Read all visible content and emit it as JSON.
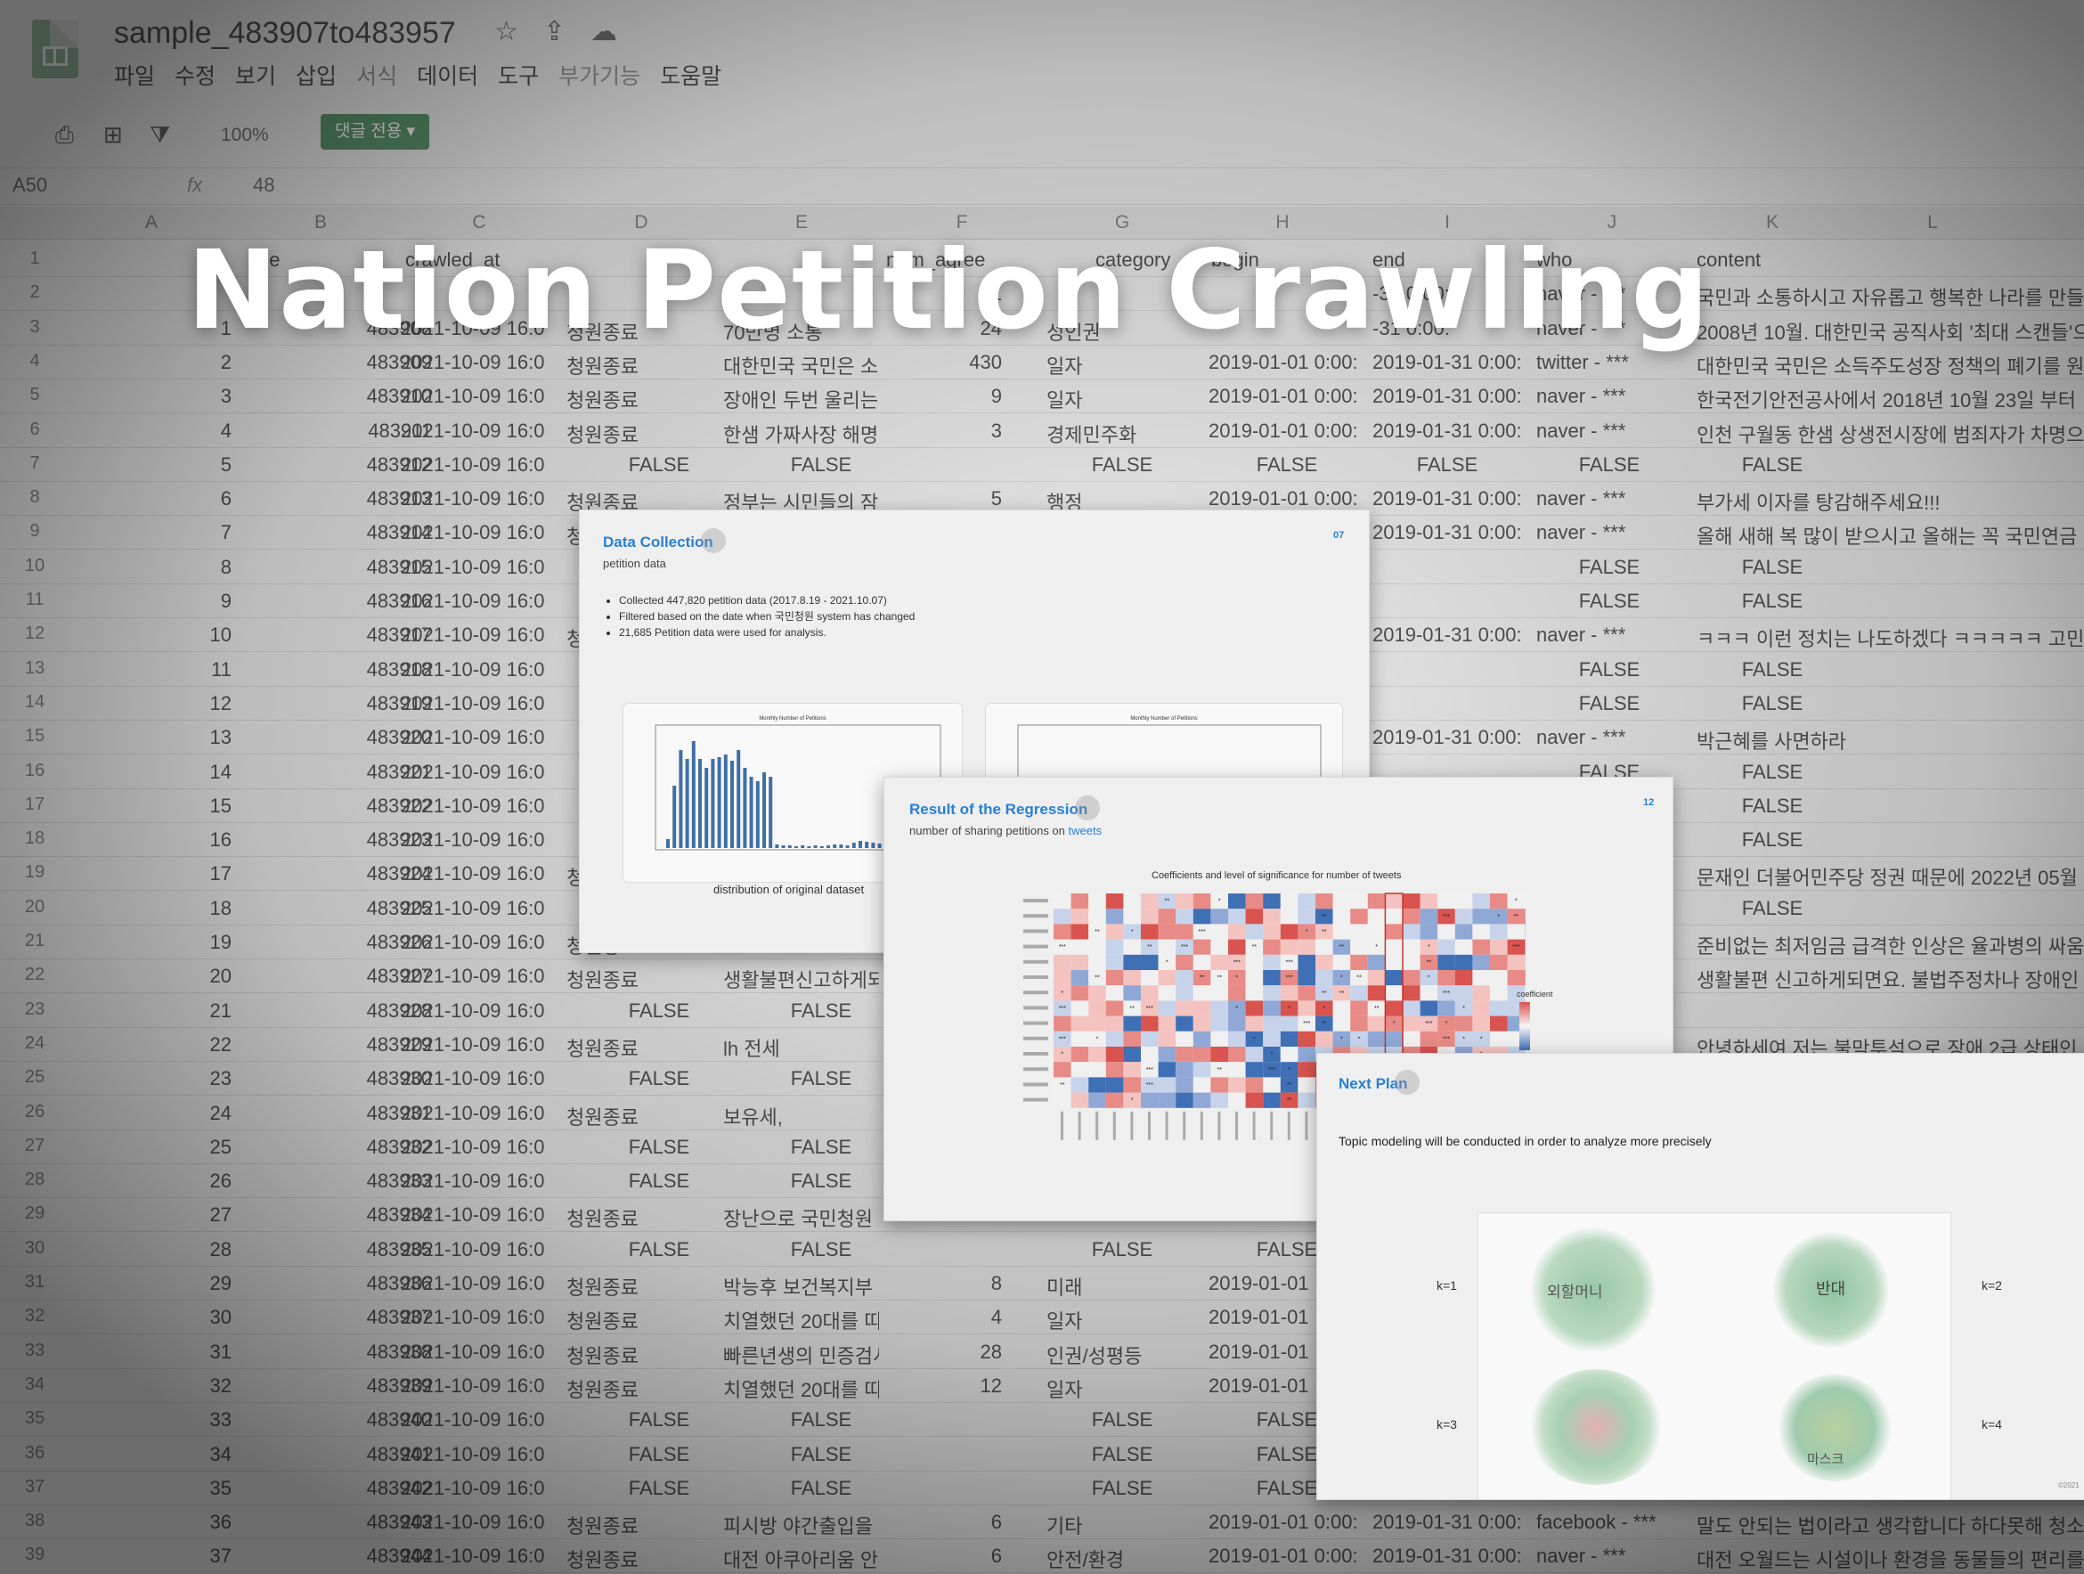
{
  "app": {
    "doc_title": "sample_483907to483957",
    "menu": [
      "파일",
      "수정",
      "보기",
      "삽입",
      "서식",
      "데이터",
      "도구",
      "부가기능",
      "도움말"
    ],
    "menu_dim": [
      false,
      false,
      false,
      false,
      true,
      false,
      false,
      true,
      false
    ],
    "zoom": "100%",
    "comment_button": "댓글 전용",
    "name_box": "A50",
    "fx": "fx",
    "formula_value": "48"
  },
  "columns": [
    "A",
    "B",
    "C",
    "D",
    "E",
    "F",
    "G",
    "H",
    "I",
    "J",
    "K",
    "L"
  ],
  "header_row": {
    "b": "ge",
    "c": "crawled_at",
    "f": "num_agree",
    "g": "category",
    "h": "begin",
    "i": "end",
    "j": "who",
    "k": "content"
  },
  "rows": [
    {
      "n": "2",
      "a": "",
      "b": "",
      "c": "",
      "d": "",
      "e": "",
      "f": "1",
      "g": "",
      "h": "",
      "i": "-31 0:00:",
      "j": "naver - ***",
      "k": "국민과 소통하시고 자유롭고 행복한 나라를 만들"
    },
    {
      "n": "3",
      "a": "1",
      "b": "483908",
      "c": "2021-10-09 16:0",
      "d": "청원종료",
      "e": "70만명 소통",
      "f": "24",
      "g": "성인권",
      "h": "",
      "i": "-31 0:00:",
      "j": "naver - ***",
      "k": "2008년 10월. 대한민국 공직사회 '최대 스캔들'으"
    },
    {
      "n": "4",
      "a": "2",
      "b": "483909",
      "c": "2021-10-09 16:0",
      "d": "청원종료",
      "e": "대한민국 국민은 소",
      "f": "430",
      "g": "일자",
      "h": "2019-01-01 0:00:",
      "i": "2019-01-31 0:00:",
      "j": "twitter - ***",
      "k": "대한민국 국민은 소득주도성장 정책의 폐기를 원"
    },
    {
      "n": "5",
      "a": "3",
      "b": "483910",
      "c": "2021-10-09 16:0",
      "d": "청원종료",
      "e": "장애인 두번 울리는",
      "f": "9",
      "g": "일자",
      "h": "2019-01-01 0:00:",
      "i": "2019-01-31 0:00:",
      "j": "naver - ***",
      "k": "한국전기안전공사에서 2018년 10월 23일 부터"
    },
    {
      "n": "6",
      "a": "4",
      "b": "483911",
      "c": "2021-10-09 16:0",
      "d": "청원종료",
      "e": "한샘 가짜사장 해명",
      "f": "3",
      "g": "경제민주화",
      "h": "2019-01-01 0:00:",
      "i": "2019-01-31 0:00:",
      "j": "naver - ***",
      "k": "인천 구월동 한샘 상생전시장에 범죄자가 차명으"
    },
    {
      "n": "7",
      "a": "5",
      "b": "483912",
      "c": "2021-10-09 16:0",
      "false": true
    },
    {
      "n": "8",
      "a": "6",
      "b": "483913",
      "c": "2021-10-09 16:0",
      "d": "청원종료",
      "e": "정부는 시민들의 잠",
      "f": "5",
      "g": "행정",
      "h": "2019-01-01 0:00:",
      "i": "2019-01-31 0:00:",
      "j": "naver - ***",
      "k": "부가세 이자를 탕감해주세요!!!"
    },
    {
      "n": "9",
      "a": "7",
      "b": "483914",
      "c": "2021-10-09 16:0",
      "d": "청원종료",
      "e": "",
      "f": "",
      "g": "",
      "h": "",
      "i": "2019-01-31 0:00:",
      "j": "naver - ***",
      "k": "올해 새해 복 많이 받으시고 올해는 꼭 국민연금"
    },
    {
      "n": "10",
      "a": "8",
      "b": "483915",
      "c": "2021-10-09 16:0",
      "partial": "FALSE"
    },
    {
      "n": "11",
      "a": "9",
      "b": "483916",
      "c": "2021-10-09 16:0",
      "partial": "FALSE"
    },
    {
      "n": "12",
      "a": "10",
      "b": "483917",
      "c": "2021-10-09 16:0",
      "d": "청원종료",
      "e": "",
      "f": "",
      "g": "",
      "h": "",
      "i": "2019-01-31 0:00:",
      "j": "naver - ***",
      "k": "ㅋㅋㅋ 이런 정치는 나도하겠다 ㅋㅋㅋㅋㅋ 고민"
    },
    {
      "n": "13",
      "a": "11",
      "b": "483918",
      "c": "2021-10-09 16:0",
      "partial": "FALSE"
    },
    {
      "n": "14",
      "a": "12",
      "b": "483919",
      "c": "2021-10-09 16:0",
      "partial": "FALSE"
    },
    {
      "n": "15",
      "a": "13",
      "b": "483920",
      "c": "2021-10-09 16:0",
      "d": "",
      "e": "",
      "f": "",
      "g": "",
      "h": "",
      "i": "2019-01-31 0:00:",
      "j": "naver - ***",
      "k": "박근혜를 사면하라"
    },
    {
      "n": "16",
      "a": "14",
      "b": "483921",
      "c": "2021-10-09 16:0",
      "partial": "FALSE"
    },
    {
      "n": "17",
      "a": "15",
      "b": "483922",
      "c": "2021-10-09 16:0",
      "partial": "FALSE"
    },
    {
      "n": "18",
      "a": "16",
      "b": "483923",
      "c": "2021-10-09 16:0",
      "partial": "FALSE"
    },
    {
      "n": "19",
      "a": "17",
      "b": "483924",
      "c": "2021-10-09 16:0",
      "d": "청원종료",
      "e": "",
      "f": "",
      "g": "",
      "h": "",
      "i": "",
      "j": "",
      "k": "문재인 더불어민주당 정권 때문에 2022년 05월"
    },
    {
      "n": "20",
      "a": "18",
      "b": "483925",
      "c": "2021-10-09 16:0",
      "partial": "FALSE"
    },
    {
      "n": "21",
      "a": "19",
      "b": "483926",
      "c": "2021-10-09 16:0",
      "d": "청원종료",
      "e": "",
      "f": "",
      "g": "",
      "h": "",
      "i": "",
      "j": "",
      "k": "준비없는 최저임금 급격한 인상은  율과병의 싸움"
    },
    {
      "n": "22",
      "a": "20",
      "b": "483927",
      "c": "2021-10-09 16:0",
      "d": "청원종료",
      "e": "생활불편신고하게되",
      "f": "",
      "g": "",
      "h": "",
      "i": "",
      "j": "",
      "k": "생활불편 신고하게되면요. 불법주정차나 장애인"
    },
    {
      "n": "23",
      "a": "21",
      "b": "483928",
      "c": "2021-10-09 16:0",
      "false_short": true
    },
    {
      "n": "24",
      "a": "22",
      "b": "483929",
      "c": "2021-10-09 16:0",
      "d": "청원종료",
      "e": "lh 전세",
      "f": "",
      "g": "",
      "h": "",
      "i": "",
      "j": "",
      "k": "안녕하세여 저는 불막투석으로 장애 2급 상태인"
    },
    {
      "n": "25",
      "a": "23",
      "b": "483930",
      "c": "2021-10-09 16:0",
      "false_short": true
    },
    {
      "n": "26",
      "a": "24",
      "b": "483931",
      "c": "2021-10-09 16:0",
      "d": "청원종료",
      "e": "보유세,",
      "f": "",
      "g": "",
      "h": "",
      "i": "",
      "j": "",
      "k": ""
    },
    {
      "n": "27",
      "a": "25",
      "b": "483932",
      "c": "2021-10-09 16:0",
      "false_short": true
    },
    {
      "n": "28",
      "a": "26",
      "b": "483933",
      "c": "2021-10-09 16:0",
      "false_short": true
    },
    {
      "n": "29",
      "a": "27",
      "b": "483934",
      "c": "2021-10-09 16:0",
      "d": "청원종료",
      "e": "장난으로 국민청원",
      "f": "",
      "g": "",
      "h": "",
      "i": "",
      "j": "",
      "k": ""
    },
    {
      "n": "30",
      "a": "28",
      "b": "483935",
      "c": "2021-10-09 16:0",
      "false_short": true
    },
    {
      "n": "31",
      "a": "29",
      "b": "483936",
      "c": "2021-10-09 16:0",
      "d": "청원종료",
      "e": "박능후 보건복지부",
      "f": "8",
      "g": "미래",
      "h": "2019-01-01",
      "i": "",
      "j": "",
      "k": ""
    },
    {
      "n": "32",
      "a": "30",
      "b": "483937",
      "c": "2021-10-09 16:0",
      "d": "청원종료",
      "e": "치열했던 20대를 띠",
      "f": "4",
      "g": "일자",
      "h": "2019-01-01",
      "i": "",
      "j": "",
      "k": ""
    },
    {
      "n": "33",
      "a": "31",
      "b": "483938",
      "c": "2021-10-09 16:0",
      "d": "청원종료",
      "e": "빠른년생의 민증검시",
      "f": "28",
      "g": "인권/성평등",
      "h": "2019-01-01",
      "i": "",
      "j": "",
      "k": ""
    },
    {
      "n": "34",
      "a": "32",
      "b": "483939",
      "c": "2021-10-09 16:0",
      "d": "청원종료",
      "e": "치열했던 20대를 띠",
      "f": "12",
      "g": "일자",
      "h": "2019-01-01",
      "i": "",
      "j": "",
      "k": ""
    },
    {
      "n": "35",
      "a": "33",
      "b": "483940",
      "c": "2021-10-09 16:0",
      "false_short": true
    },
    {
      "n": "36",
      "a": "34",
      "b": "483941",
      "c": "2021-10-09 16:0",
      "false_short": true
    },
    {
      "n": "37",
      "a": "35",
      "b": "483942",
      "c": "2021-10-09 16:0",
      "false_short": true
    },
    {
      "n": "38",
      "a": "36",
      "b": "483943",
      "c": "2021-10-09 16:0",
      "d": "청원종료",
      "e": "피시방 야간출입을",
      "f": "6",
      "g": "기타",
      "h": "2019-01-01 0:00:",
      "i": "2019-01-31 0:00:",
      "j": "facebook - ***",
      "k": "말도 안되는 법이라고 생각합니다 하다못해 청소"
    },
    {
      "n": "39",
      "a": "37",
      "b": "483944",
      "c": "2021-10-09 16:0",
      "d": "청원종료",
      "e": "대전 아쿠아리움 안",
      "f": "6",
      "g": "안전/환경",
      "h": "2019-01-01 0:00:",
      "i": "2019-01-31 0:00:",
      "j": "naver - ***",
      "k": "대전 오월드는 시설이나 환경을 동물들의 편리를"
    }
  ],
  "false_text": "FALSE",
  "hero_title": "Nation Petition Crawling",
  "slide1": {
    "title": "Data Collection",
    "subtitle": "petition data",
    "page": "07",
    "bullets": [
      "Collected 447,820 petition data (2017.8.19 - 2021.10.07)",
      "Filtered based on the date when 국민청원 system has changed",
      "21,685 Petition data were used for analysis."
    ],
    "chart1_title": "Monthly Number of Petitions",
    "chart2_title": "Monthly Number of Petitions",
    "caption": "distribution of original dataset"
  },
  "slide2": {
    "title": "Result of the Regression",
    "subtitle_pre": "number of sharing petitions on ",
    "subtitle_link": "tweets",
    "page": "12",
    "heatmap_title": "Coefficients and level of significance for number of tweets",
    "legend_title": "coefficient"
  },
  "slide3": {
    "title": "Next Plan",
    "text": "Topic modeling will be conducted in order to analyze more precisely",
    "k_labels": [
      "k=1",
      "k=2",
      "k=3",
      "k=4"
    ],
    "cloud_words": [
      "외할머니",
      "반대",
      "마스크"
    ],
    "footer": "©2021"
  },
  "colors": {
    "accent": "#2a7fd4",
    "sheet_green": "#5f9a70",
    "heat_red": "#d9534f",
    "heat_blue": "#3f6fb5"
  }
}
